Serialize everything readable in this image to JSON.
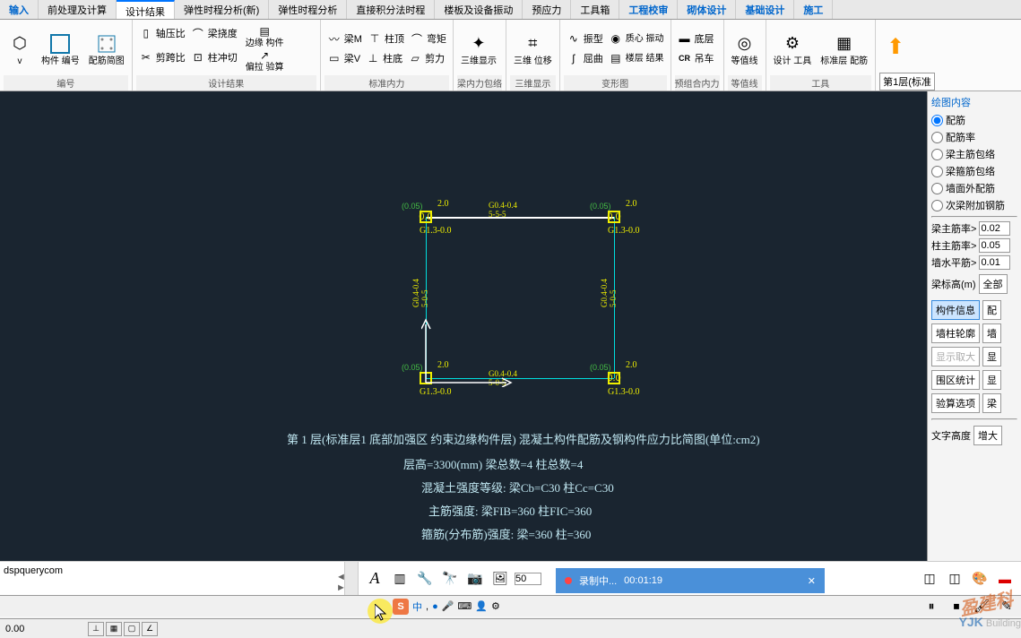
{
  "tabs": {
    "items": [
      "输入",
      "前处理及计算",
      "设计结果",
      "弹性时程分析(新)",
      "弹性时程分析",
      "直接积分法时程",
      "楼板及设备振动",
      "预应力",
      "工具箱",
      "工程校审",
      "砌体设计",
      "基础设计",
      "施工"
    ],
    "blue_indices": [
      9,
      10,
      11,
      12
    ],
    "active_index": 2
  },
  "ribbon": {
    "g0": {
      "label": "编号",
      "btn1": "构件\n编号",
      "btn2": "配筋简图"
    },
    "g1": {
      "label": "设计结果",
      "axisratio": "轴压比",
      "shearspan": "剪跨比",
      "beamdeflect": "梁挠度",
      "colshear": "柱冲切",
      "edge": "边缘\n构件",
      "eccen": "偏拉\n验算"
    },
    "g2": {
      "label": "标准内力",
      "m": "梁M",
      "v": "梁V",
      "ctop": "柱顶",
      "cbot": "柱底",
      "bend": "弯矩",
      "shear": "剪力"
    },
    "g3": {
      "label": "梁内力包络",
      "disp3d": "三维显示"
    },
    "g4": {
      "label": "三维显示",
      "pos3d": "三维\n位移"
    },
    "g5": {
      "label": "变形图",
      "mode": "振型",
      "bend": "屈曲",
      "cent": "质心\n振动",
      "res": "楼层\n结果"
    },
    "g6": {
      "label": "预组合内力",
      "bot": "底层",
      "cr": "吊车"
    },
    "g7": {
      "label": "等值线",
      "iso": "等值线"
    },
    "g8": {
      "label": "工具",
      "tool": "设计\n工具",
      "std": "标准层\n配筋"
    },
    "layer": "第1层(标准"
  },
  "side": {
    "title": "绘图内容",
    "radios": [
      "配筋",
      "配筋率",
      "梁主筋包络",
      "梁箍筋包络",
      "墙面外配筋",
      "次梁附加钢筋"
    ],
    "selected": 0,
    "rows": [
      {
        "label": "梁主筋率>",
        "val": "0.02"
      },
      {
        "label": "柱主筋率>",
        "val": "0.05"
      },
      {
        "label": "墙水平筋>",
        "val": "0.01"
      },
      {
        "label": "梁标高(m)",
        "val": "全部"
      }
    ],
    "btns": [
      [
        "构件信息",
        "配"
      ],
      [
        "墙柱轮廓",
        "墙"
      ],
      [
        "显示取大",
        "显"
      ],
      [
        "围区统计",
        "显"
      ],
      [
        "验算选项",
        "梁"
      ]
    ],
    "texth": "文字高度",
    "enlarge": "增大"
  },
  "canvas_text": [
    "第 1 层(标准层1 底部加强区 约束边缘构件层) 混凝土构件配筋及钢构件应力比简图(单位:cm2)",
    "层高=3300(mm) 梁总数=4 柱总数=4",
    "混凝土强度等级: 梁Cb=C30 柱Cc=C30",
    "主筋强度: 梁FIB=360 柱FIC=360",
    "箍筋(分布筋)强度: 梁=360 柱=360"
  ],
  "diagram": {
    "tl": {
      "val": "0.0",
      "g": "(0.05)",
      "t": "2.0",
      "c": "G1.3-0.0"
    },
    "tr": {
      "val": "0.0",
      "g": "(0.05)",
      "t": "2.0",
      "c": "G1.3-0.0"
    },
    "bl": {
      "val": "",
      "g": "(0.05)",
      "t": "2.0",
      "c": "G1.3-0.0"
    },
    "br": {
      "val": "0.0",
      "g": "(0.05)",
      "t": "2.0",
      "c": "G1.3-0.0"
    },
    "beam_t": "G0.4-0.4\n5-5-5",
    "beam_b": "G0.4-0.4\n5-0-5",
    "beam_l": "G0.4-0.4\n5-0-5",
    "beam_r": "G0.4-0.4\n5-0-5"
  },
  "cmd": "dspquerycom",
  "coord": "0.00",
  "toolbar": {
    "zoom": "50"
  },
  "recording": {
    "text": "录制中...",
    "time": "00:01:19"
  },
  "ime": [
    "中",
    ",",
    "●",
    "↓",
    "◆",
    "↑",
    "↓"
  ],
  "wm": {
    "logo": "YJK",
    "text": "盈建科",
    "sub": "Building"
  }
}
